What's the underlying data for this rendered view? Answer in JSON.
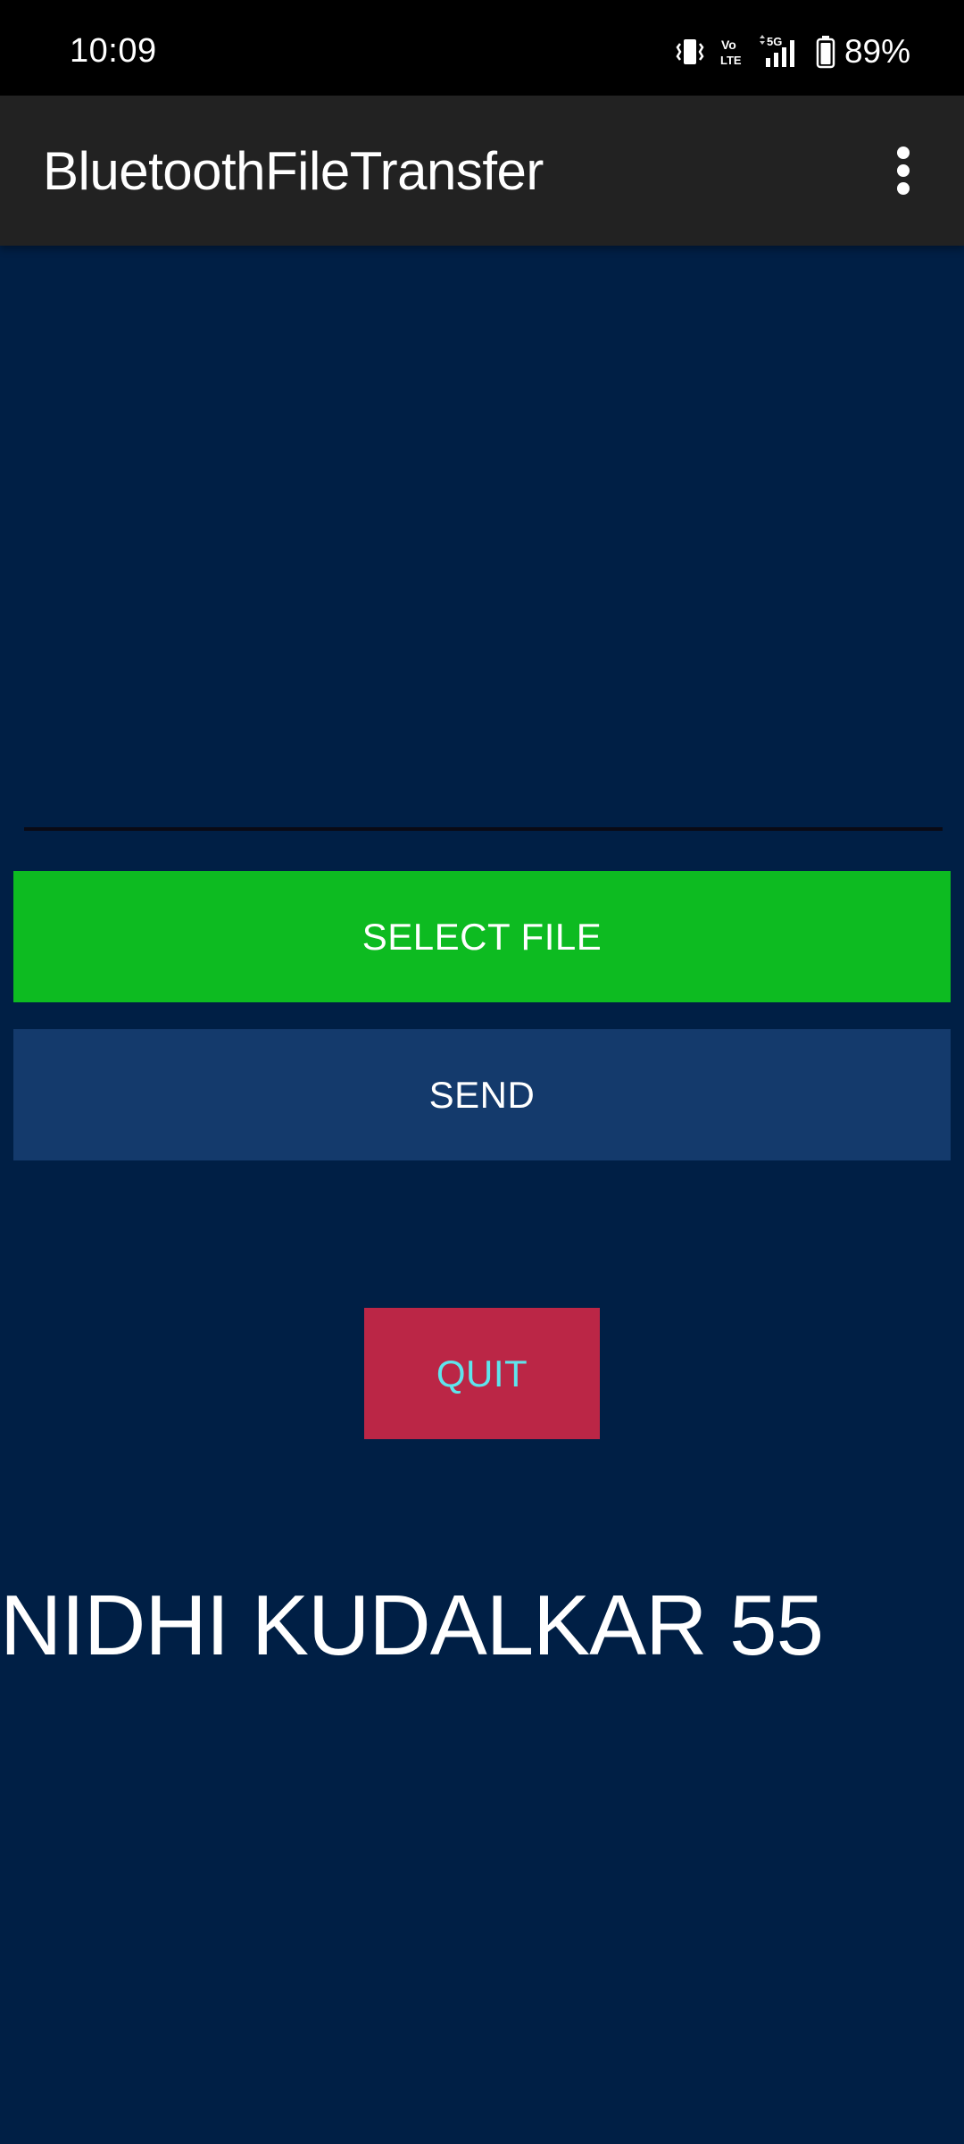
{
  "status_bar": {
    "time": "10:09",
    "network": "5G",
    "volte": "Vo LTE",
    "battery": "89%"
  },
  "app_bar": {
    "title": "BluetoothFileTransfer",
    "menu_icon": "more-vert-icon"
  },
  "file_field": {
    "value": "",
    "placeholder": ""
  },
  "buttons": {
    "select_file": "SELECT FILE",
    "send": "SEND",
    "quit": "QUIT"
  },
  "footer": {
    "name": "NIDHI KUDALKAR 55"
  },
  "colors": {
    "background": "#001f45",
    "app_bar": "#222222",
    "select_button": "#0dbb21",
    "send_button": "#143a6c",
    "quit_button": "#bb2646",
    "quit_text": "#5fe4ec"
  }
}
